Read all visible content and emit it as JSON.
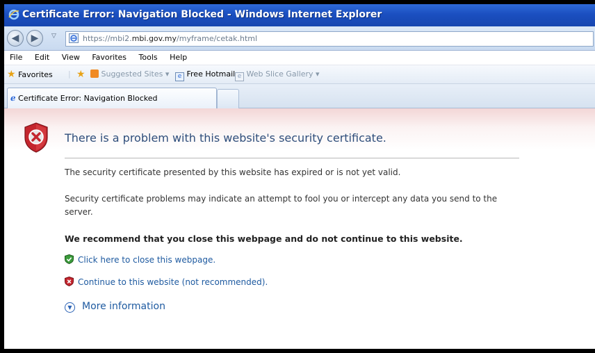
{
  "window": {
    "title": "Certificate Error: Navigation Blocked - Windows Internet Explorer"
  },
  "address": {
    "prefix": "https://mbi2.",
    "domain": "mbi.gov.my",
    "path": "/myframe/cetak.html"
  },
  "menu": {
    "items": [
      "File",
      "Edit",
      "View",
      "Favorites",
      "Tools",
      "Help"
    ]
  },
  "favorites": {
    "label": "Favorites",
    "suggested": "Suggested Sites ▾",
    "hotmail": "Free Hotmail",
    "gallery": "Web Slice Gallery ▾"
  },
  "tab": {
    "label": "Certificate Error: Navigation Blocked"
  },
  "page": {
    "heading": "There is a problem with this website's security certificate.",
    "p1": "The security certificate presented by this website has expired or is not yet valid.",
    "p2": "Security certificate problems may indicate an attempt to fool you or intercept any data you send to the server.",
    "recommend": "We recommend that you close this webpage and do not continue to this website.",
    "close_link": "Click here to close this webpage.",
    "continue_link": "Continue to this website (not recommended).",
    "more_info": "More information"
  },
  "colors": {
    "title_bar": "#1b4fc0",
    "link": "#1e5aa0",
    "heading": "#2f4e7b"
  }
}
